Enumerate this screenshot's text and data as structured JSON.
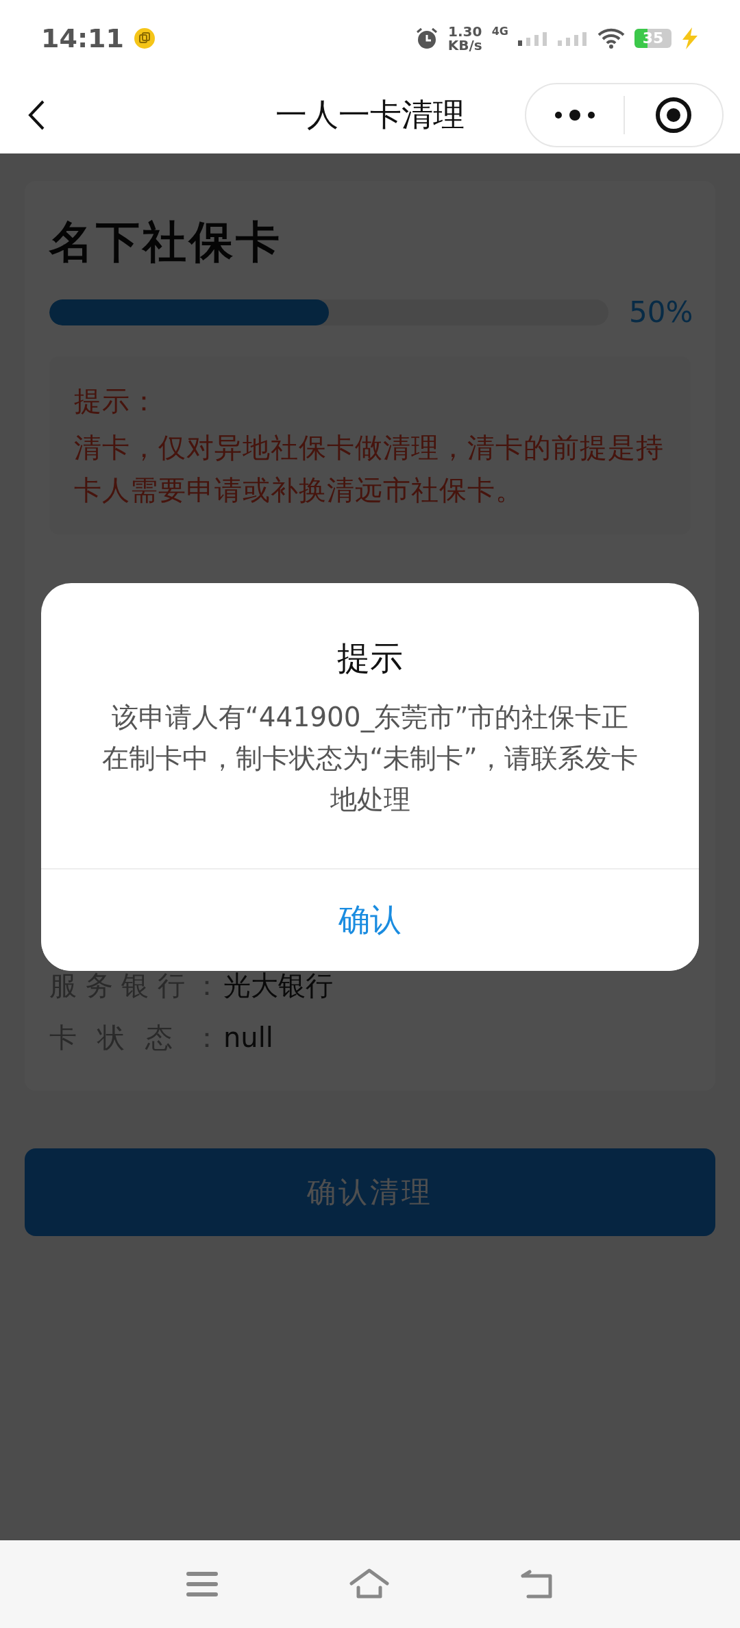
{
  "status_bar": {
    "time": "14:11",
    "net_speed": "1.30",
    "net_unit": "KB/s",
    "network": "4G",
    "battery": "35"
  },
  "nav": {
    "title": "一人一卡清理"
  },
  "card": {
    "title": "名下社保卡",
    "progress": {
      "level": 0.5,
      "label": "50%"
    },
    "tip": {
      "heading": "提示：",
      "text": "清卡，仅对异地社保卡做清理，清卡的前提是持卡人需要申请或补换清远市社保卡。"
    },
    "fields": [
      {
        "label": "服务银行：",
        "value": "光大银行"
      },
      {
        "label": "卡状态：",
        "value": "null"
      }
    ]
  },
  "primary_button": "确认清理",
  "dialog": {
    "title": "提示",
    "message": "该申请人有“441900_东莞市”市的社保卡正在制卡中，制卡状态为“未制卡”，请联系发卡地处理",
    "confirm": "确认"
  }
}
